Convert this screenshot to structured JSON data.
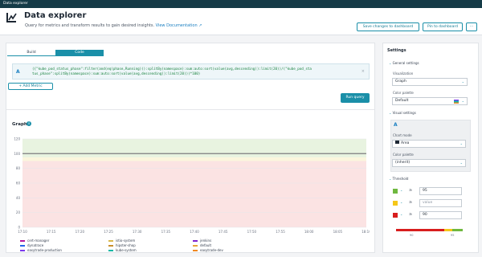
{
  "topbar": {
    "title": "Data explorer"
  },
  "header": {
    "title": "Data explorer",
    "subtitle": "Query for metrics and transform results to gain desired insights.",
    "doc_link": "View Documentation ↗",
    "save_btn": "Save changes to dashboard",
    "pin_btn": "Pin to dashboard",
    "more_btn": "···"
  },
  "tabs": {
    "build": "Build",
    "code": "Code"
  },
  "query": {
    "letter": "A",
    "code_line1": "({\"kube_pod_status_phase\":filter(and(eq(phase,Running))):splitBy(namespace):sum:auto:sort(value(avg,descending)):limit(20))/(\"kube_pod_sta",
    "code_line2": "tus_phase\":splitBy(namespace):sum:auto:sort(value(avg,descending)):limit(20)))*100)",
    "close": "×"
  },
  "buttons": {
    "add_metric": "+  Add Metric",
    "run_query": "Run query"
  },
  "graph": {
    "title": "Graph",
    "info": "i"
  },
  "chart_data": {
    "type": "line",
    "y_ticks": [
      "120",
      "100",
      "80",
      "60",
      "40",
      "20",
      "0"
    ],
    "ylim": [
      0,
      120
    ],
    "x": [
      "17:10",
      "17:15",
      "17:20",
      "17:25",
      "17:30",
      "17:35",
      "17:40",
      "17:45",
      "17:50",
      "17:55",
      "18:00",
      "18:05",
      "18:10"
    ],
    "series": [
      {
        "name": "cert-manager",
        "color": "#b5179e",
        "values": [
          100,
          100,
          100,
          100,
          100,
          100,
          100,
          100,
          100,
          100,
          100,
          100,
          100
        ]
      },
      {
        "name": "dynatrace",
        "color": "#2563eb",
        "values": [
          100,
          100,
          100,
          100,
          100,
          100,
          100,
          100,
          100,
          100,
          100,
          100,
          100
        ]
      },
      {
        "name": "easytrade-production",
        "color": "#7c3aed",
        "values": [
          100,
          100,
          100,
          100,
          100,
          100,
          100,
          100,
          100,
          100,
          100,
          100,
          100
        ]
      },
      {
        "name": "istio-system",
        "color": "#d9b84a",
        "values": [
          100,
          100,
          100,
          100,
          100,
          100,
          100,
          100,
          100,
          100,
          100,
          100,
          100
        ]
      },
      {
        "name": "hipster-shop",
        "color": "#c98f2c",
        "values": [
          100,
          100,
          100,
          100,
          100,
          100,
          100,
          100,
          100,
          100,
          100,
          100,
          100
        ]
      },
      {
        "name": "kube-system",
        "color": "#14b8a6",
        "values": [
          100,
          100,
          100,
          100,
          100,
          100,
          100,
          100,
          100,
          100,
          100,
          100,
          100
        ]
      },
      {
        "name": "jenkins",
        "color": "#7e22ce",
        "values": [
          100,
          100,
          100,
          100,
          100,
          100,
          100,
          100,
          100,
          100,
          100,
          100,
          100
        ]
      },
      {
        "name": "default",
        "color": "#e8a33a",
        "values": [
          100,
          100,
          100,
          100,
          100,
          100,
          100,
          100,
          100,
          100,
          100,
          100,
          100
        ]
      },
      {
        "name": "easytrade-dev",
        "color": "#f08a24",
        "values": [
          100,
          100,
          100,
          100,
          100,
          100,
          100,
          100,
          100,
          100,
          100,
          100,
          100
        ]
      }
    ],
    "threshold_bands": [
      {
        "from": 95,
        "to": 120,
        "color": "#e8f3e0"
      },
      {
        "from": 90,
        "to": 95,
        "color": "#fbf6dd"
      },
      {
        "from": 0,
        "to": 90,
        "color": "#fbe3e3"
      }
    ]
  },
  "settings": {
    "title": "Settings",
    "general": "General settings",
    "visualization_label": "Visualization",
    "visualization_value": "Graph",
    "palette_label": "Color palette",
    "palette_value": "Default",
    "visual_settings": "Visual settings",
    "series_letter": "A",
    "chart_mode_label": "Chart mode",
    "chart_mode_value": "Area",
    "color_palette_label": "Color palette",
    "color_palette_value": "(inherit)",
    "threshold": "Threshold",
    "thresholds": [
      {
        "color": "#6fb83f",
        "op": "≥",
        "value": "95"
      },
      {
        "color": "#f5c71a",
        "op": "≥",
        "value": "value"
      },
      {
        "color": "#d81e1e",
        "op": "≥",
        "value": "90"
      }
    ],
    "gauge_min": "90",
    "gauge_max": "95"
  }
}
